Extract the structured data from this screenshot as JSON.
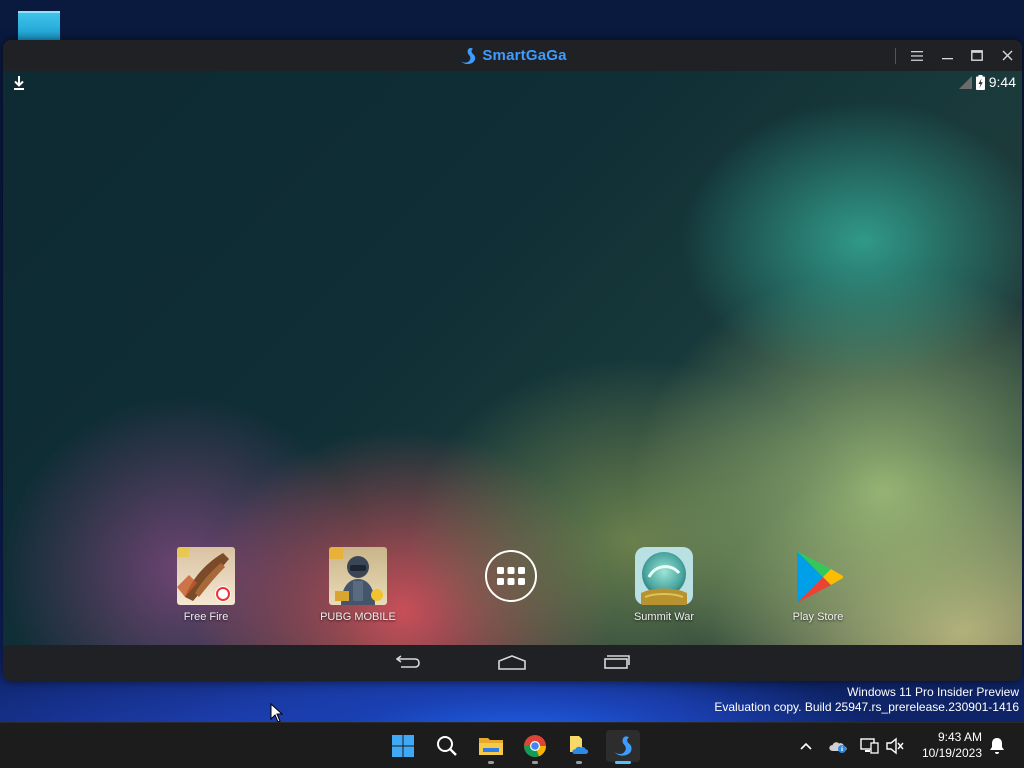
{
  "window": {
    "title": "SmartGaGa",
    "controls": [
      "menu",
      "minimize",
      "maximize",
      "close"
    ]
  },
  "android": {
    "status_bar": {
      "time": "9:44"
    },
    "dock": [
      {
        "label": "Free Fire",
        "icon": "free-fire-icon"
      },
      {
        "label": "PUBG MOBILE",
        "icon": "pubg-mobile-icon"
      },
      {
        "label": "",
        "icon": "all-apps-icon"
      },
      {
        "label": "Summit War",
        "icon": "summit-war-icon"
      },
      {
        "label": "Play Store",
        "icon": "play-store-icon"
      }
    ],
    "nav": [
      "back",
      "home",
      "recents"
    ]
  },
  "desktop": {
    "watermark_line1": "Windows 11 Pro Insider Preview",
    "watermark_line2": "Evaluation copy. Build 25947.rs_prerelease.230901-1416"
  },
  "taskbar": {
    "apps": [
      "start",
      "search",
      "file-explorer",
      "chrome",
      "onedrive-files",
      "smartgaga"
    ],
    "active_app": "smartgaga",
    "clock_time": "9:43 AM",
    "clock_date": "10/19/2023"
  },
  "colors": {
    "brand_blue": "#3f9cff",
    "window_bg": "#202124",
    "taskbar_bg": "#1c1c1c",
    "accent": "#4cc2ff"
  }
}
